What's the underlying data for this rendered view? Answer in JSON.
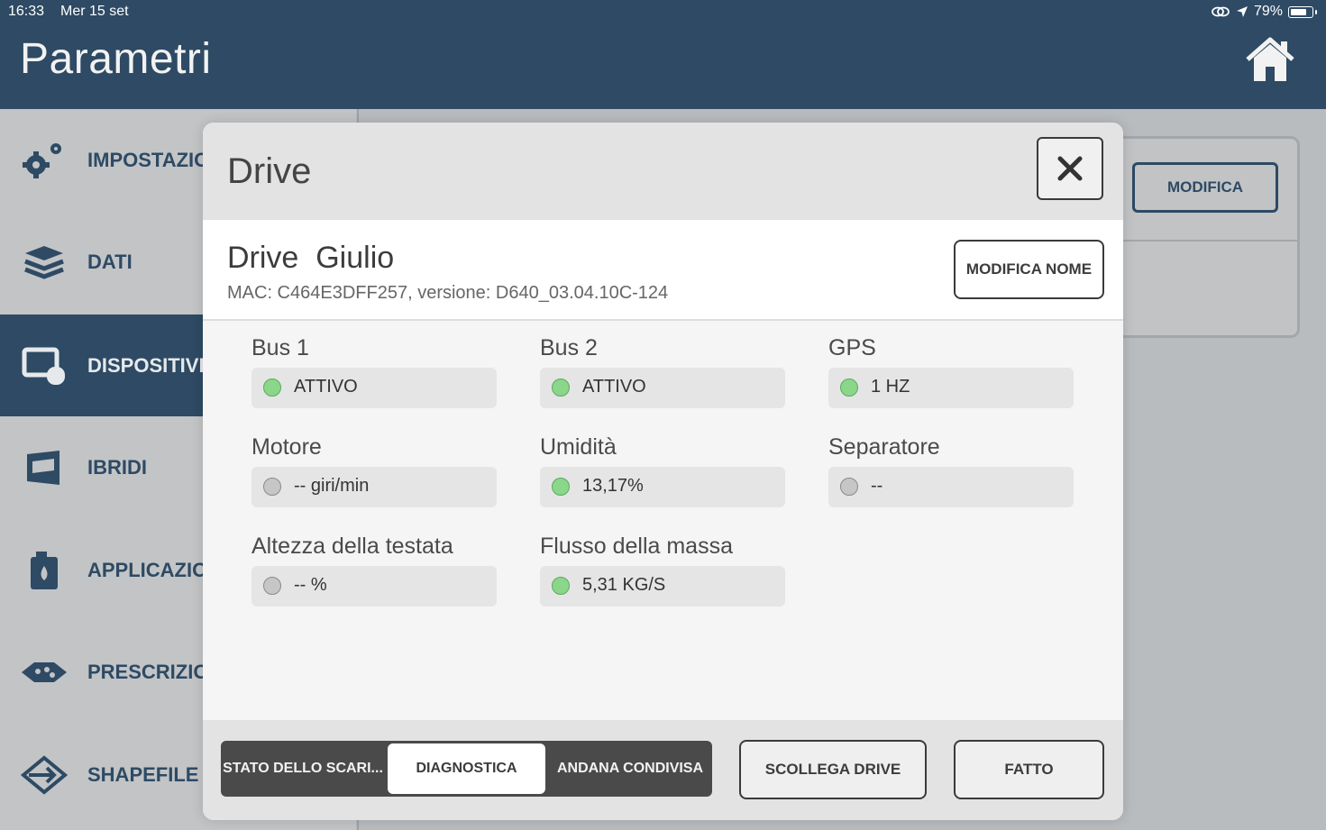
{
  "status_bar": {
    "time": "16:33",
    "date": "Mer 15 set",
    "battery": "79%",
    "battery_level": 0.79
  },
  "header": {
    "title": "Parametri"
  },
  "sidebar": {
    "items": [
      {
        "label": "IMPOSTAZIONI",
        "icon": "gears-icon"
      },
      {
        "label": "DATI",
        "icon": "layers-icon"
      },
      {
        "label": "DISPOSITIVI",
        "icon": "devices-icon",
        "active": true
      },
      {
        "label": "IBRIDI",
        "icon": "seed-bag-icon"
      },
      {
        "label": "APPLICAZIONI",
        "icon": "fluid-container-icon"
      },
      {
        "label": "PRESCRIZIONI",
        "icon": "prescription-map-icon"
      },
      {
        "label": "SHAPEFILE",
        "icon": "import-arrow-icon"
      }
    ]
  },
  "background": {
    "modifica_label": "MODIFICA"
  },
  "modal": {
    "title": "Drive",
    "device_name": "Drive  Giulio",
    "device_info": "MAC: C464E3DFF257, versione: D640_03.04.10C-124",
    "rename_label": "MODIFICA NOME",
    "diagnostics": [
      {
        "label": "Bus 1",
        "value": "ATTIVO",
        "ok": true
      },
      {
        "label": "Bus 2",
        "value": "ATTIVO",
        "ok": true
      },
      {
        "label": "GPS",
        "value": "1 HZ",
        "ok": true
      },
      {
        "label": "Motore",
        "value": "-- giri/min",
        "ok": false
      },
      {
        "label": "Umidità",
        "value": "13,17%",
        "ok": true
      },
      {
        "label": "Separatore",
        "value": "--",
        "ok": false
      },
      {
        "label": "Altezza della testata",
        "value": "-- %",
        "ok": false
      },
      {
        "label": "Flusso della massa",
        "value": "5,31 KG/S",
        "ok": true
      }
    ],
    "tabs": [
      {
        "label": "STATO DELLO SCARI..."
      },
      {
        "label": "DIAGNOSTICA",
        "active": true
      },
      {
        "label": "ANDANA CONDIVISA"
      }
    ],
    "disconnect_label": "SCOLLEGA DRIVE",
    "done_label": "FATTO"
  },
  "colors": {
    "header": "#2e4a64",
    "status_ok": "#8ad68a",
    "status_off": "#c6c6c6"
  }
}
